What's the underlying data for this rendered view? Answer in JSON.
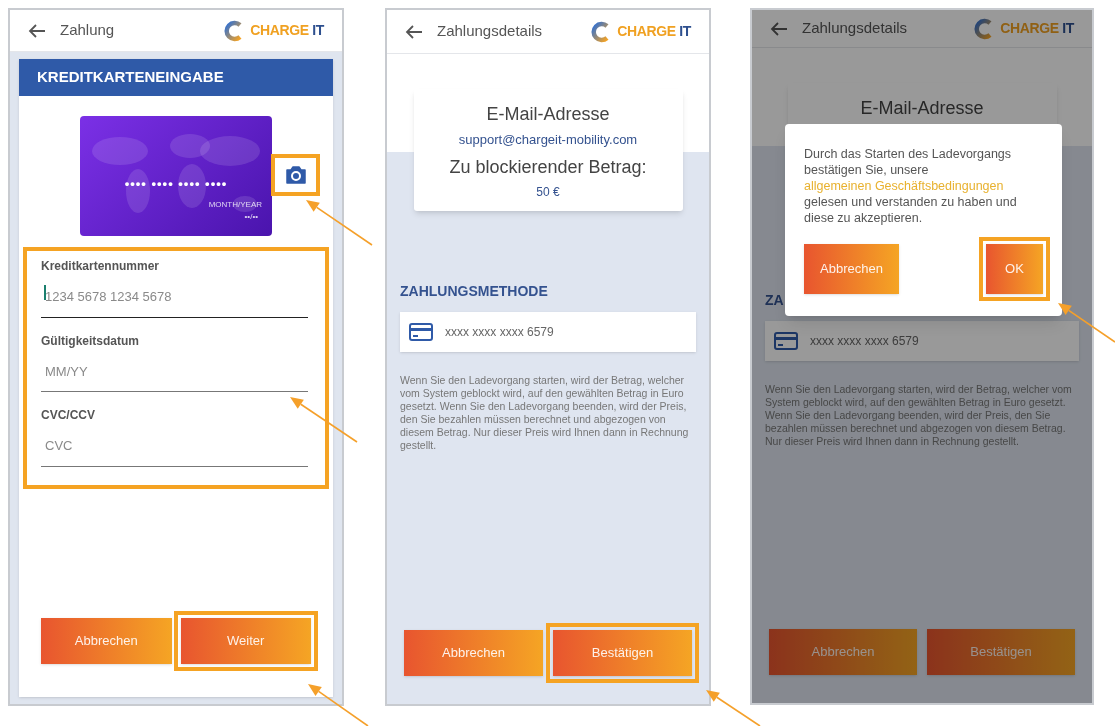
{
  "screens": [
    {
      "kind": "card_entry",
      "title": "Zahlung",
      "logo": [
        "CHARGE",
        "IT"
      ],
      "panel_title": "KREDITKARTENEINGABE",
      "card": {
        "number": "•••• •••• •••• ••••",
        "expiry_label": "MONTH/YEAR",
        "expiry": "••/••",
        "camera_highlighted": true
      },
      "fields_highlighted": true,
      "fields": [
        {
          "label": "Kreditkartennummer",
          "placeholder": "1234 5678 1234 5678",
          "focused": true
        },
        {
          "label": "Gültigkeitsdatum",
          "placeholder": "MM/YY",
          "focused": false
        },
        {
          "label": "CVC/CCV",
          "placeholder": "CVC",
          "focused": false
        }
      ],
      "buttons": [
        {
          "label": "Abbrechen",
          "highlighted": false
        },
        {
          "label": "Weiter",
          "highlighted": true
        }
      ]
    },
    {
      "kind": "details",
      "dimmed": false,
      "title": "Zahlungsdetails",
      "logo": [
        "CHARGE",
        "IT"
      ],
      "email_label": "E-Mail-Adresse",
      "email": "support@chargeit-mobility.com",
      "amount_label": "Zu blockierender Betrag:",
      "amount": "50 €",
      "method_heading": "ZAHLUNGSMETHODE",
      "card_number": "xxxx xxxx xxxx 6579",
      "note": "Wenn Sie den Ladevorgang starten, wird der Betrag, welcher vom System geblockt wird, auf den gewählten Betrag in Euro gesetzt. Wenn Sie den Ladevorgang beenden, wird der Preis, den Sie bezahlen müssen berechnet und abgezogen von diesem Betrag. Nur dieser Preis wird Ihnen dann in Rechnung gestellt.",
      "buttons": [
        {
          "label": "Abbrechen",
          "highlighted": false
        },
        {
          "label": "Bestätigen",
          "highlighted": true
        }
      ]
    },
    {
      "kind": "details",
      "dimmed": true,
      "title": "Zahlungsdetails",
      "logo": [
        "CHARGE",
        "IT"
      ],
      "email_label": "E-Mail-Adresse",
      "method_heading": "ZA",
      "card_number": "xxxx xxxx xxxx 6579",
      "note": "Wenn Sie den Ladevorgang starten, wird der Betrag, welcher vom System geblockt wird, auf den gewählten Betrag in Euro gesetzt. Wenn Sie den Ladevorgang beenden, wird der Preis, den Sie bezahlen müssen berechnet und abgezogen von diesem Betrag. Nur dieser Preis wird Ihnen dann in Rechnung gestellt.",
      "buttons": [
        {
          "label": "Abbrechen",
          "highlighted": false
        },
        {
          "label": "Bestätigen",
          "highlighted": false
        }
      ],
      "dialog": {
        "text_before": "Durch das Starten des Ladevorgangs bestätigen Sie, unsere ",
        "link": "allgemeinen Geschäftsbedingungen",
        "text_after": " gelesen und verstanden zu haben und diese zu akzeptieren.",
        "buttons": [
          {
            "label": "Abbrechen",
            "highlighted": false
          },
          {
            "label": "OK",
            "highlighted": true
          }
        ]
      }
    }
  ]
}
